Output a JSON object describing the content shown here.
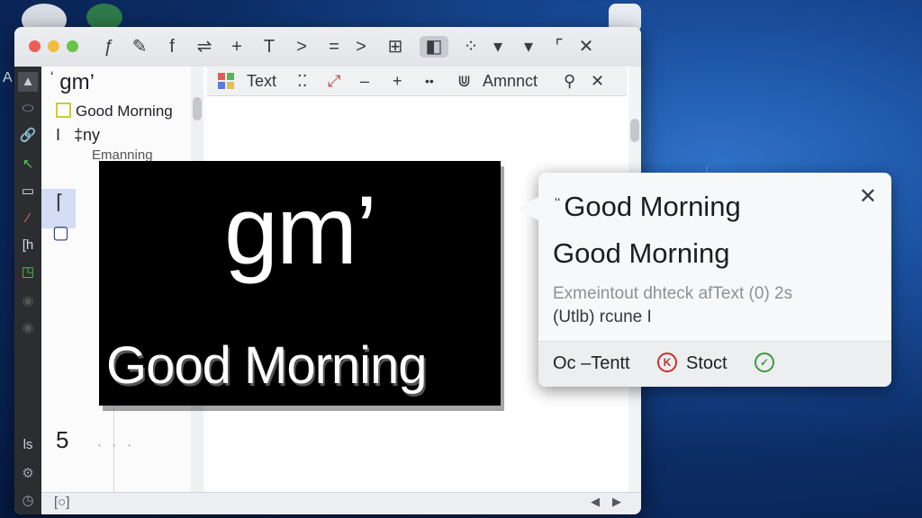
{
  "desktop": {
    "side_letter": "A"
  },
  "window": {
    "toolbar": [
      {
        "glyph": "ƒ",
        "name": "function-icon"
      },
      {
        "glyph": "✎",
        "name": "pen-icon"
      },
      {
        "glyph": "f",
        "name": "font-icon"
      },
      {
        "glyph": "⇌",
        "name": "swap-icon"
      },
      {
        "glyph": "+",
        "name": "add-icon"
      },
      {
        "glyph": "T",
        "name": "text-tool-icon"
      },
      {
        "glyph": ">",
        "name": "chevron-right-icon"
      },
      {
        "glyph": "=",
        "name": "equals-icon"
      },
      {
        "glyph": ">",
        "name": "next-icon"
      },
      {
        "glyph": "⊞",
        "name": "grid-icon"
      },
      {
        "glyph": "◧",
        "name": "layout-icon"
      },
      {
        "glyph": "⁘",
        "name": "dots-grid-icon"
      },
      {
        "glyph": "▾",
        "name": "dropdown-icon"
      },
      {
        "glyph": "▾",
        "name": "dropdown-2-icon"
      },
      {
        "glyph": "⌜",
        "name": "corner-icon"
      },
      {
        "glyph": "✕",
        "name": "close-icon"
      }
    ],
    "leftbar": [
      {
        "glyph": "▲",
        "name": "layers-icon"
      },
      {
        "glyph": "⬭",
        "name": "shape-icon"
      },
      {
        "glyph": "🔗",
        "name": "link-icon"
      },
      {
        "glyph": "↖",
        "name": "select-icon"
      },
      {
        "glyph": "▭",
        "name": "screen-icon"
      },
      {
        "glyph": "⁄",
        "name": "brush-icon"
      },
      {
        "glyph": "[h",
        "name": "bracket-icon"
      },
      {
        "glyph": "◳",
        "name": "frame-icon"
      },
      {
        "glyph": "◉",
        "name": "target-icon"
      },
      {
        "glyph": "◉",
        "name": "target-2-icon"
      },
      {
        "glyph": "ls",
        "name": "list-icon"
      },
      {
        "glyph": "⚙",
        "name": "settings-icon"
      },
      {
        "glyph": "◷",
        "name": "history-icon"
      }
    ],
    "panel": {
      "title": "gm’",
      "title_prefix": "ʻ",
      "item1": "Good Morning",
      "item2_a": "I",
      "item2_b": "‡ny",
      "item3": "Emanning",
      "number": "5",
      "dots": "· · ·"
    },
    "canvas_toolbar": {
      "text_label": "Text",
      "amount_label": "Amnnct"
    },
    "statusbar": {
      "left": "[○]",
      "prev": "◀",
      "next": "▶"
    }
  },
  "graphic": {
    "gm": "gm’",
    "subtitle": "Good Morning"
  },
  "popup": {
    "line1_prefix": "ʻʻ",
    "line1": "Good Morning",
    "line2": "Good Morning",
    "desc1": "Exmeintout dhteck afText (0) 2s",
    "desc2": "(Utlb) rcune I",
    "footer_left": "Oc –Tentt",
    "footer_right": "Stoct",
    "close": "✕"
  },
  "colors": {
    "accent_checkbox": "#c7cf2c",
    "selection": "#d3dcf2",
    "desktop": "#0c2d66"
  }
}
